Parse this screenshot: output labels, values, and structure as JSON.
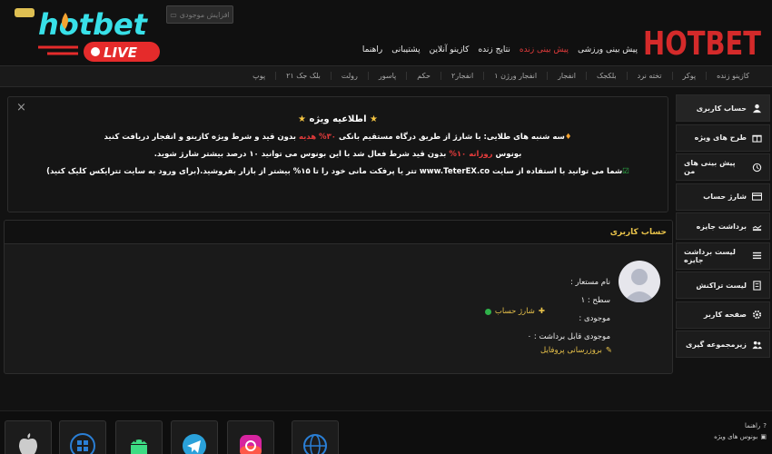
{
  "header": {
    "wallet_label": "افزایش موجودی",
    "logo_left_text": "hotbet",
    "logo_left_sub": "LIVE",
    "logo_right_text": "HOTBET",
    "nav": [
      {
        "label": "پیش بینی ورزشی",
        "active": false
      },
      {
        "label": "پیش بینی زنده",
        "active": true
      },
      {
        "label": "نتایج زنده",
        "active": false
      },
      {
        "label": "کازینو آنلاین",
        "active": false
      },
      {
        "label": "پشتیبانی",
        "active": false
      },
      {
        "label": "راهنما",
        "active": false
      }
    ]
  },
  "sub_nav": [
    "کازینو زنده",
    "پوکر",
    "تخته نرد",
    "بلکجک",
    "انفجار",
    "انفجار ورژن ۱",
    "انفجار۲",
    "حکم",
    "پاسور",
    "رولت",
    "بلک جک ۲۱",
    "پوپ"
  ],
  "sidebar": [
    {
      "label": "حساب کاربری",
      "icon": "user-icon",
      "active": true
    },
    {
      "label": "طرح های ویژه",
      "icon": "gift-icon",
      "active": false
    },
    {
      "label": "پیش بینی های من",
      "icon": "history-icon",
      "active": false
    },
    {
      "label": "شارژ حساب",
      "icon": "card-icon",
      "active": false
    },
    {
      "label": "برداشت جایزه",
      "icon": "withdraw-icon",
      "active": false
    },
    {
      "label": "لیست برداشت جایزه",
      "icon": "list-icon",
      "active": false
    },
    {
      "label": "لیست تراکنش",
      "icon": "receipt-icon",
      "active": false
    },
    {
      "label": "صفحه کاربر",
      "icon": "gear-icon",
      "active": false
    },
    {
      "label": "زیرمجموعه گیری",
      "icon": "users-icon",
      "active": false
    }
  ],
  "announcement": {
    "title": "اطلاعیه ویژه",
    "line1_a": "سه شنبه های طلایی: با شارژ از طریق درگاه مستقیم بانکی ",
    "line1_hl": "۳۰% هدیه",
    "line1_b": " بدون قید و شرط ویژه کازینو و انفجار دریافت کنید",
    "line2_a": "بونوس ",
    "line2_hl": "روزانه ۱۰%",
    "line2_b": " بدون قید شرط فعال شد با این بونوس می توانید ۱۰ درصد بیشتر شارژ شوید.",
    "line3": "شما می توانید با استفاده از سایت www.TeterEX.co تتر یا پرفکت مانی خود را تا ۱۵% بیشتر از بازار بفروشید.(برای ورود به سایت تترایکس کلیک کنید)"
  },
  "account": {
    "header": "حساب کاربری",
    "username_label": "نام مستعار :",
    "level_label": "سطح : ۱",
    "balance_label": "موجودی :",
    "withdrawable_label": "موجودی قابل برداشت : ۰",
    "charge_link": "شارژ حساب",
    "profile_link": "بروزرسانی پروفایل"
  },
  "footer": {
    "links": [
      "راهنما",
      "بونوس های ویژه"
    ],
    "apps": [
      "apple-icon",
      "windows-icon",
      "android-icon",
      "telegram-icon",
      "instagram-icon",
      "web-icon"
    ]
  },
  "colors": {
    "accent_red": "#e23b3b",
    "accent_gold": "#e8c24a",
    "bg": "#121212"
  }
}
